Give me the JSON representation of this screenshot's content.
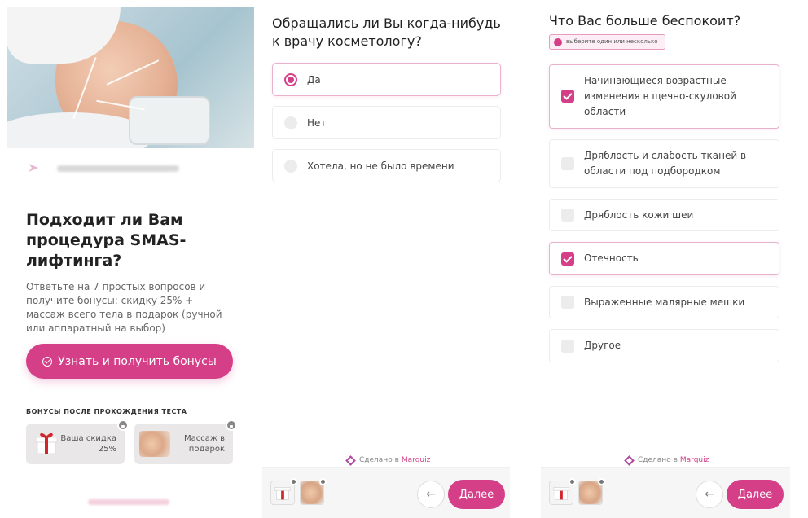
{
  "panel1": {
    "title": "Подходит ли Вам процедура SMAS-лифтинга?",
    "subtitle": "Ответьте на 7 простых вопросов и получите бонусы: скидку 25% + массаж всего тела в подарок (ручной или аппаратный на выбор)",
    "cta_label": "Узнать и получить бонусы",
    "bonus_heading": "БОНУСЫ ПОСЛЕ ПРОХОЖДЕНИЯ ТЕСТА",
    "bonuses": [
      {
        "label": "Ваша скидка 25%",
        "icon": "gift-icon"
      },
      {
        "label": "Массаж в подарок",
        "icon": "massage-photo"
      }
    ]
  },
  "panel2": {
    "question": "Обращались ли Вы когда-нибудь к врачу косметологу?",
    "options": [
      {
        "label": "Да",
        "selected": true
      },
      {
        "label": "Нет",
        "selected": false
      },
      {
        "label": "Хотела, но не было времени",
        "selected": false
      }
    ],
    "made_by_prefix": "Сделано в",
    "made_by_brand": "Marquiz",
    "next_label": "Далее"
  },
  "panel3": {
    "question": "Что Вас больше беспокоит?",
    "hint": "выберите один или несколько",
    "options": [
      {
        "label": "Начинающиеся возрастные изменения в щечно-скуловой области",
        "checked": true
      },
      {
        "label": "Дряблость и слабость тканей в области под подбородком",
        "checked": false
      },
      {
        "label": "Дряблость кожи шеи",
        "checked": false
      },
      {
        "label": "Отечность",
        "checked": true
      },
      {
        "label": "Выраженные малярные мешки",
        "checked": false
      },
      {
        "label": "Другое",
        "checked": false
      }
    ],
    "made_by_prefix": "Сделано в",
    "made_by_brand": "Marquiz",
    "next_label": "Далее"
  },
  "colors": {
    "accent": "#d43f88",
    "option_border": "#ececec",
    "selected_border": "#e8b2cc"
  }
}
